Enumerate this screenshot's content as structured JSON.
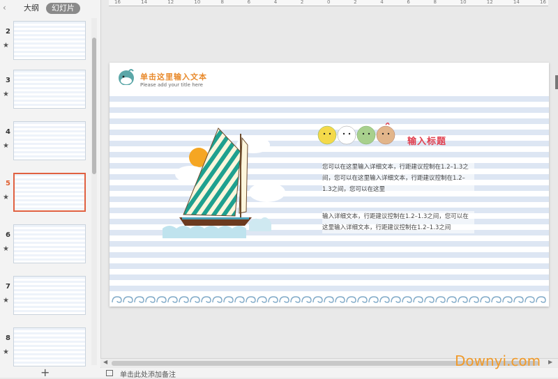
{
  "panel": {
    "tab_outline": "大纲",
    "tab_slides": "幻灯片",
    "add_label": "+",
    "thumbnails": [
      {
        "num": "2",
        "star": "★"
      },
      {
        "num": "3",
        "star": "★"
      },
      {
        "num": "4",
        "star": "★"
      },
      {
        "num": "5",
        "star": "★"
      },
      {
        "num": "6",
        "star": "★"
      },
      {
        "num": "7",
        "star": "★"
      },
      {
        "num": "8",
        "star": "★"
      }
    ],
    "selected_index": 3
  },
  "ruler_labels": [
    "16",
    "14",
    "12",
    "10",
    "8",
    "6",
    "4",
    "2",
    "0",
    "2",
    "4",
    "6",
    "8",
    "10",
    "12",
    "14",
    "16"
  ],
  "slide": {
    "title": "单击这里输入文本",
    "subtitle": "Please add your title here",
    "heading": "输入标题",
    "paragraph1": "您可以在这里输入详细文本，行距建议控制在1.2–1.3之间，您可以在这里输入详细文本，行距建议控制在1.2–1.3之间，您可以在这里",
    "paragraph2": "输入详细文本，行距建议控制在1.2–1.3之间，您可以在这里输入详细文本，行距建议控制在1.2–1.3之间"
  },
  "notes": {
    "placeholder": "单击此处添加备注"
  },
  "watermark": {
    "text": "Downyi.com"
  },
  "colors": {
    "accent_orange": "#e8892a",
    "heading_red": "#e04050",
    "stripe_blue": "#dde6f3",
    "sail_teal": "#1fa08f"
  }
}
